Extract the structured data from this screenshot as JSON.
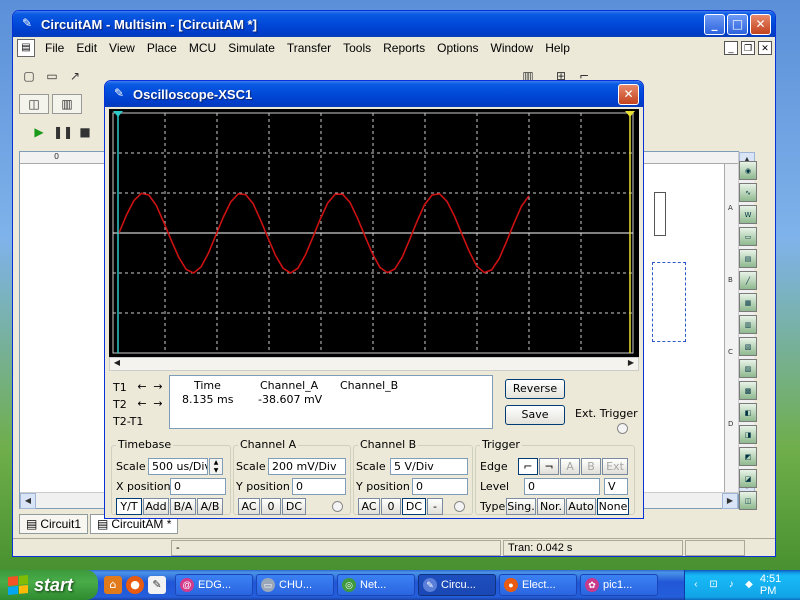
{
  "main_window": {
    "title": "CircuitAM - Multisim - [CircuitAM *]",
    "menu": [
      "File",
      "Edit",
      "View",
      "Place",
      "MCU",
      "Simulate",
      "Transfer",
      "Tools",
      "Reports",
      "Options",
      "Window",
      "Help"
    ],
    "help_glyph": "?",
    "ruler_top_label": "0",
    "ruler_right_labels": [
      "A",
      "B",
      "C",
      "D"
    ],
    "bottom_tabs": [
      "Circuit1",
      "CircuitAM *"
    ],
    "status": {
      "left": "-",
      "right": "Tran: 0.042 s"
    }
  },
  "scope": {
    "title": "Oscilloscope-XSC1",
    "screen": {
      "background": "#000000",
      "grid_color": "#cccccc",
      "trace_color": "#cc1111",
      "baseline_color": "#ffffff",
      "divisions_x": 10,
      "divisions_y": 6,
      "cursor_colors": [
        "#2ec8c8",
        "#e8e030"
      ]
    },
    "chart_data": {
      "type": "line",
      "series": [
        {
          "name": "Channel_A",
          "samples": [
            0.0,
            0.45,
            0.81,
            0.99,
            0.95,
            0.69,
            0.27,
            -0.18,
            -0.6,
            -0.91,
            -1.0,
            -0.85,
            -0.5,
            -0.05,
            0.4,
            0.78,
            0.98,
            0.96,
            0.73,
            0.32,
            -0.13,
            -0.56,
            -0.88,
            -1.0,
            -0.88,
            -0.55,
            -0.11,
            0.35,
            0.75,
            0.97,
            0.97,
            0.76,
            0.37,
            -0.08,
            -0.52,
            -0.86,
            -0.99,
            -0.9,
            -0.6,
            -0.16,
            0.3,
            0.71,
            0.95,
            0.98,
            0.79,
            0.42,
            -0.03,
            -0.47,
            -0.83,
            -0.99,
            -0.92,
            -0.64,
            -0.21,
            0.25,
            0.67,
            0.93
          ]
        }
      ],
      "amplitude_div": 1.0
    },
    "cursor_rows": [
      "T1",
      "T2",
      "T2-T1"
    ],
    "readout": {
      "headers": [
        "Time",
        "Channel_A",
        "Channel_B"
      ],
      "t1": [
        "8.135 ms",
        "-38.607 mV",
        ""
      ]
    },
    "buttons": {
      "reverse": "Reverse",
      "save": "Save",
      "ext_trigger": "Ext. Trigger"
    },
    "timebase": {
      "title": "Timebase",
      "scale_label": "Scale",
      "scale_value": "500 us/Div",
      "xpos_label": "X position",
      "xpos_value": "0",
      "modes": [
        "Y/T",
        "Add",
        "B/A",
        "A/B"
      ]
    },
    "channel_a": {
      "title": "Channel A",
      "scale_label": "Scale",
      "scale_value": "200 mV/Div",
      "ypos_label": "Y position",
      "ypos_value": "0",
      "coupling": [
        "AC",
        "0",
        "DC"
      ]
    },
    "channel_b": {
      "title": "Channel B",
      "scale_label": "Scale",
      "scale_value": "5  V/Div",
      "ypos_label": "Y position",
      "ypos_value": "0",
      "coupling": [
        "AC",
        "0",
        "DC",
        "-"
      ]
    },
    "trigger": {
      "title": "Trigger",
      "edge_label": "Edge",
      "edge_buttons": [
        "A",
        "B",
        "Ext"
      ],
      "level_label": "Level",
      "level_value": "0",
      "level_unit": "V",
      "type_label": "Type",
      "type_buttons": [
        "Sing.",
        "Nor.",
        "Auto",
        "None"
      ]
    }
  },
  "taskbar": {
    "start": "start",
    "tasks": [
      "EDG...",
      "CHU...",
      "Net...",
      "Circu...",
      "Elect...",
      "pic1..."
    ],
    "clock": "4:51 PM"
  }
}
